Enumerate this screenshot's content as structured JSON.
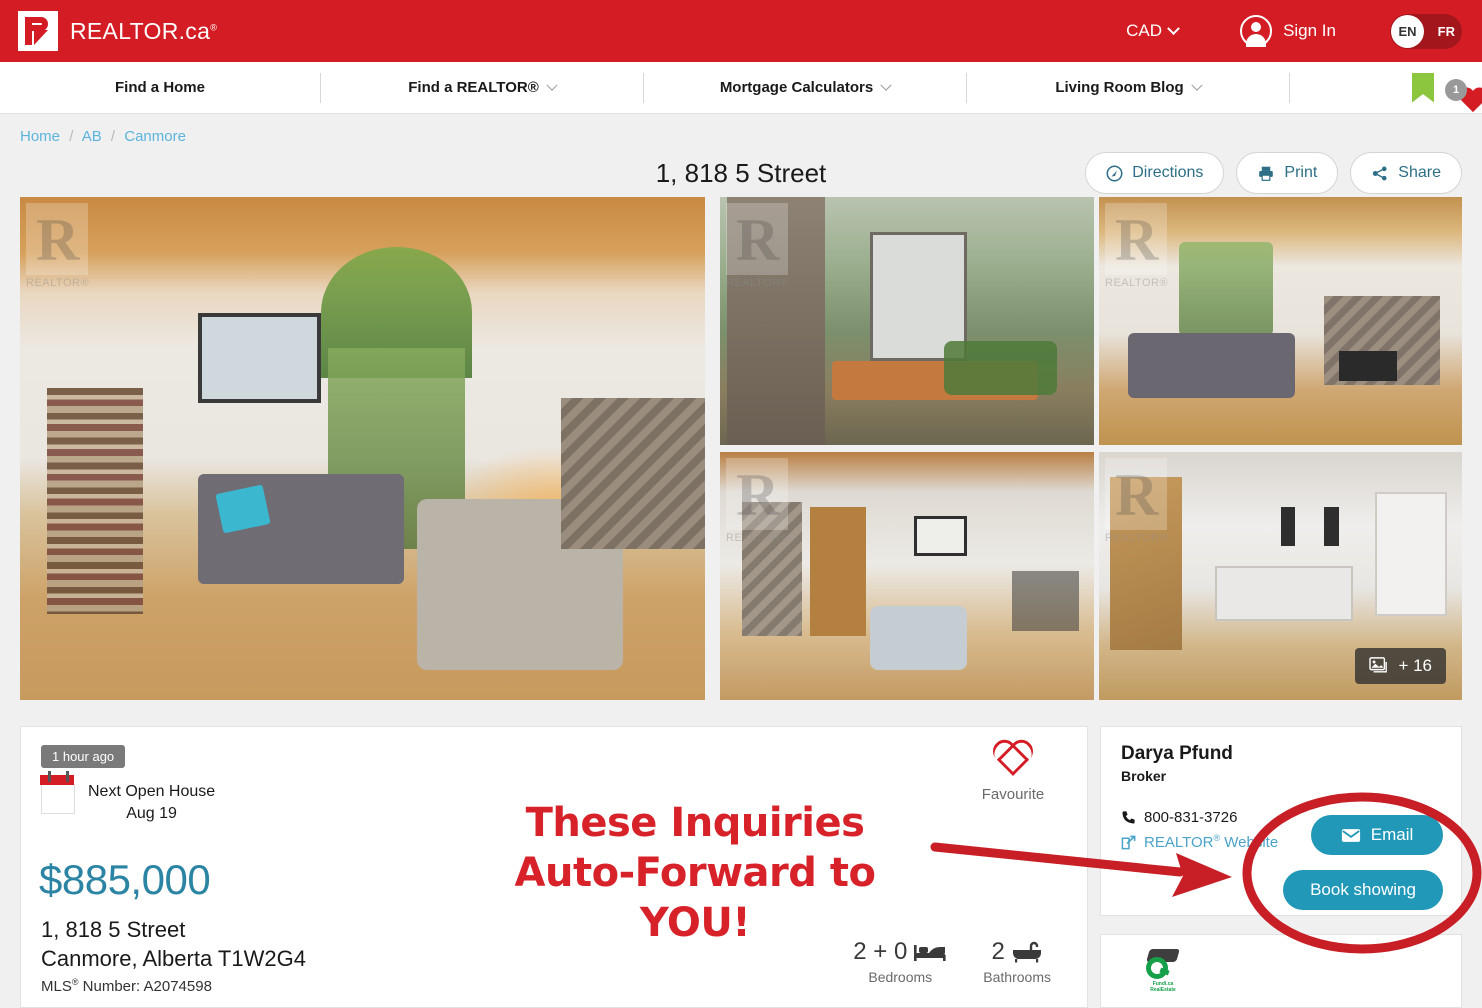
{
  "header": {
    "brand_name": "REALTOR.ca",
    "brand_sup": "®",
    "currency": "CAD",
    "sign_in": "Sign In",
    "lang_active": "EN",
    "lang_other": "FR"
  },
  "nav": {
    "items": [
      {
        "label": "Find a Home",
        "has_caret": false
      },
      {
        "label": "Find a REALTOR®",
        "has_caret": true
      },
      {
        "label": "Mortgage Calculators",
        "has_caret": true
      },
      {
        "label": "Living Room Blog",
        "has_caret": true
      }
    ],
    "favourites_count": "1"
  },
  "breadcrumb": {
    "items": [
      "Home",
      "AB",
      "Canmore"
    ],
    "separator": "/"
  },
  "page_title": "1, 818 5 Street",
  "actions": [
    {
      "label": "Directions",
      "icon": "directions-icon"
    },
    {
      "label": "Print",
      "icon": "print-icon"
    },
    {
      "label": "Share",
      "icon": "share-icon"
    }
  ],
  "gallery": {
    "watermark_text": "REALTOR®",
    "photo_count_label": "+ 16"
  },
  "listing": {
    "posted_ago": "1 hour ago",
    "open_house_title": "Next Open House",
    "open_house_date": "Aug 19",
    "price": "$885,000",
    "address_line1": "1, 818 5 Street",
    "address_line2": "Canmore, Alberta T1W2G4",
    "mls_prefix": "MLS",
    "mls_sup": "®",
    "mls_label": " Number: A2074598",
    "favourite_label": "Favourite",
    "bedrooms_value": "2 + 0",
    "bedrooms_label": "Bedrooms",
    "bathrooms_value": "2",
    "bathrooms_label": "Bathrooms"
  },
  "agent": {
    "name": "Darya Pfund",
    "role": "Broker",
    "phone": "800-831-3726",
    "website_prefix": "REALTOR",
    "website_sup": "®",
    "website_suffix": " Website",
    "email_button": "Email",
    "book_button": "Book showing"
  },
  "annotation": {
    "line1": "These Inquiries",
    "line2": "Auto-Forward to YOU!",
    "color": "#d8222a"
  },
  "colors": {
    "brand_red": "#d41c24",
    "teal": "#2298b8",
    "price_blue": "#2b84a3",
    "link_blue": "#5bb4dd",
    "green_bookmark": "#8cc63e"
  }
}
